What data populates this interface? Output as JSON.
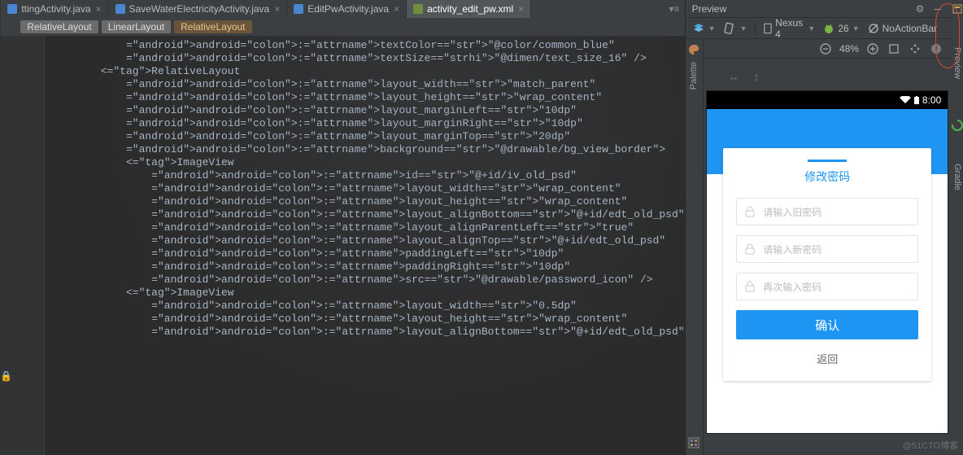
{
  "tabs": [
    {
      "label": "ttingActivity.java",
      "icon": "java",
      "active": false
    },
    {
      "label": "SaveWaterElectricityActivity.java",
      "icon": "java",
      "active": false
    },
    {
      "label": "EditPwActivity.java",
      "icon": "java",
      "active": false
    },
    {
      "label": "activity_edit_pw.xml",
      "icon": "xml",
      "active": true
    }
  ],
  "tabs_trailing_glyphs": "▾≡",
  "breadcrumbs": [
    {
      "label": "RelativeLayout",
      "style": "plain"
    },
    {
      "label": "LinearLayout",
      "style": "plain"
    },
    {
      "label": "RelativeLayout",
      "style": "orange"
    }
  ],
  "code": {
    "lines": [
      "            android:textColor=\"@color/common_blue\"",
      "            android:textSize=\"@dimen/text_size_16\" />",
      "",
      "        <RelativeLayout",
      "            android:layout_width=\"match_parent\"",
      "            android:layout_height=\"wrap_content\"",
      "            android:layout_marginLeft=\"10dp\"",
      "            android:layout_marginRight=\"10dp\"",
      "            android:layout_marginTop=\"20dp\"",
      "            android:background=\"@drawable/bg_view_border\">",
      "",
      "            <ImageView",
      "                android:id=\"@+id/iv_old_psd\"",
      "                android:layout_width=\"wrap_content\"",
      "                android:layout_height=\"wrap_content\"",
      "                android:layout_alignBottom=\"@+id/edt_old_psd\"",
      "                android:layout_alignParentLeft=\"true\"",
      "                android:layout_alignTop=\"@+id/edt_old_psd\"",
      "                android:paddingLeft=\"10dp\"",
      "                android:paddingRight=\"10dp\"",
      "                android:src=\"@drawable/password_icon\" />",
      "",
      "            <ImageView",
      "                android:layout_width=\"0.5dp\"",
      "                android:layout_height=\"wrap_content\"",
      "                android:layout_alignBottom=\"@+id/edt_old_psd\""
    ],
    "highlighted_line_index": 16
  },
  "preview": {
    "title": "Preview",
    "device": "Nexus 4",
    "api_icon": "android",
    "api_level": "26",
    "theme": "NoActionBar",
    "zoom": "48%",
    "palette_label": "Palette"
  },
  "device_preview": {
    "status_time": "8:00",
    "card_title": "修改密码",
    "fields": [
      {
        "placeholder": "请输入旧密码"
      },
      {
        "placeholder": "请输入新密码"
      },
      {
        "placeholder": "再次输入密码"
      }
    ],
    "confirm": "确认",
    "back": "返回"
  },
  "right_tools": {
    "preview_label": "Preview",
    "gradle_label": "Gradle"
  },
  "watermark": "@51CTO博客"
}
